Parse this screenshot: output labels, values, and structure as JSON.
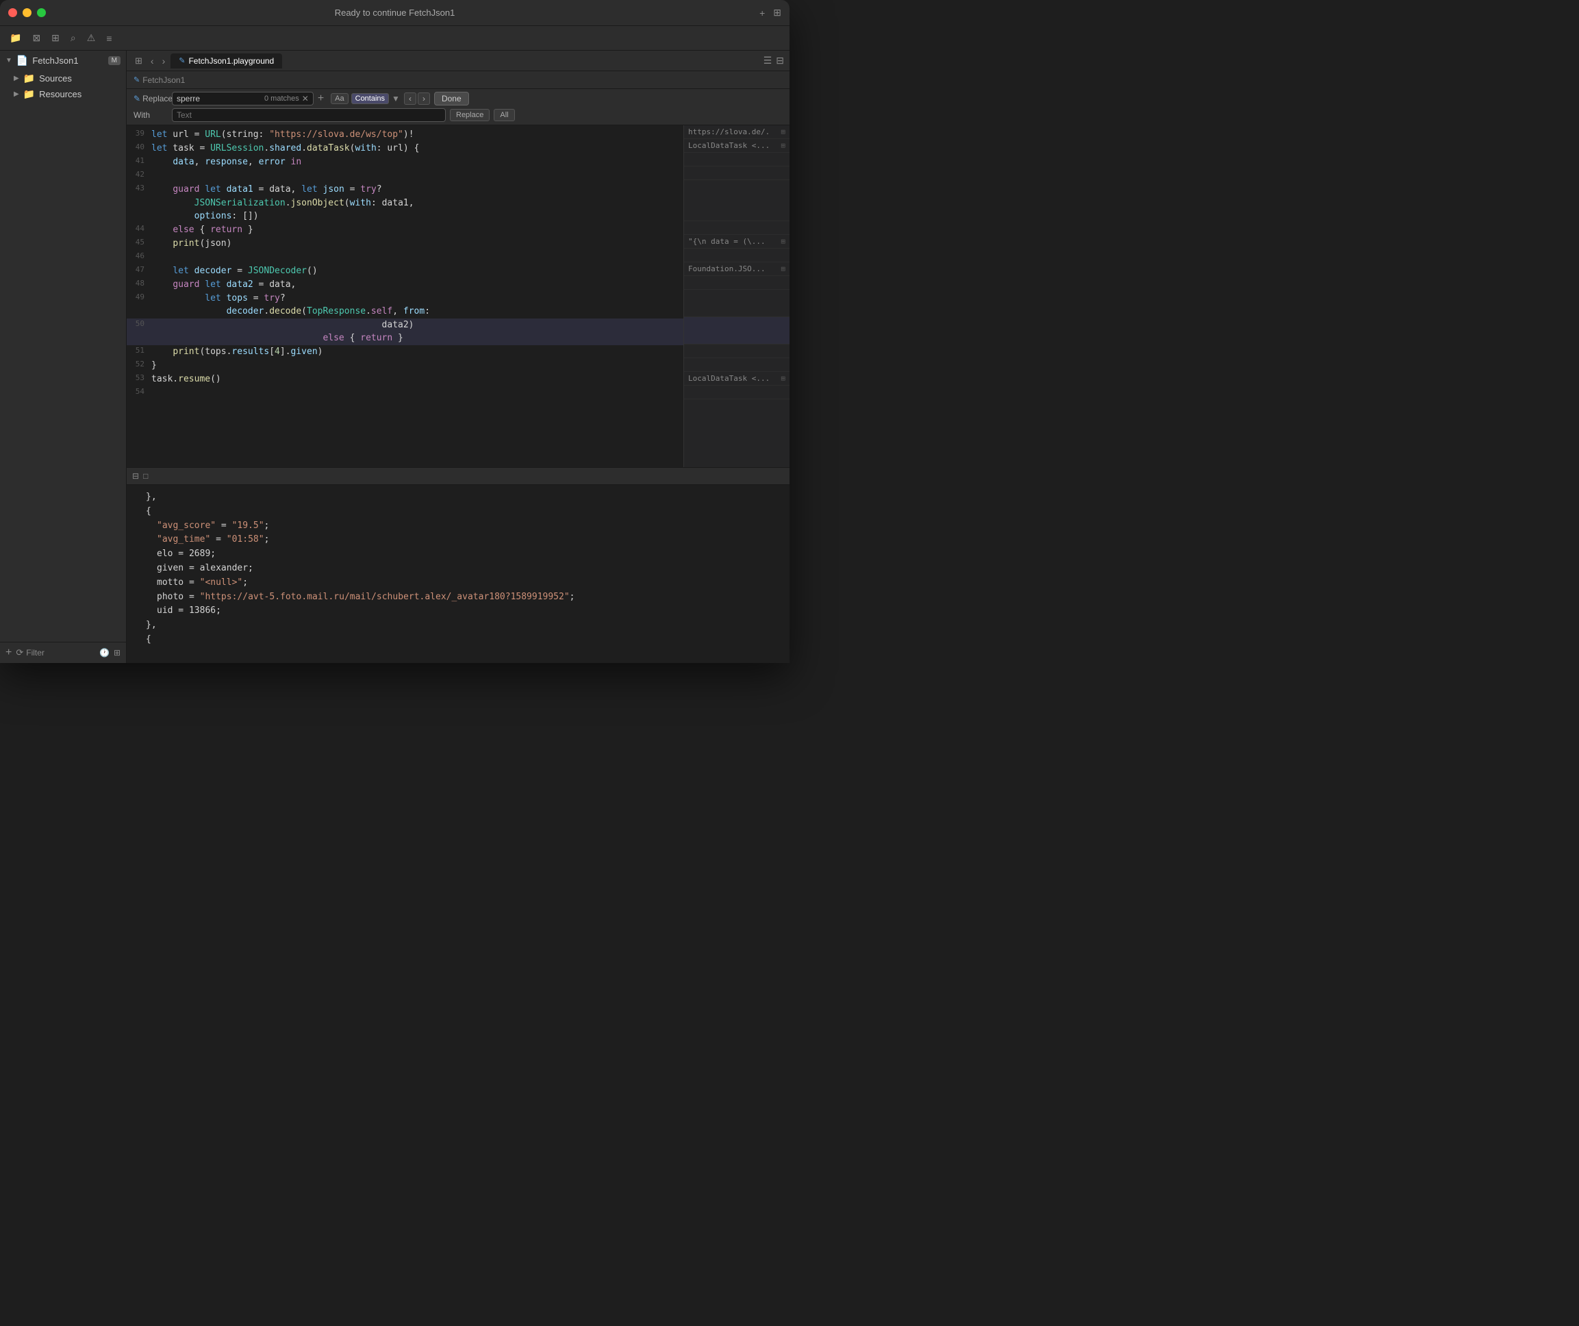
{
  "titlebar": {
    "title": "Ready to continue FetchJson1",
    "traffic_lights": [
      "red",
      "yellow",
      "green"
    ]
  },
  "toolbar": {
    "icons": [
      "folder",
      "x-square",
      "grid",
      "search",
      "warning",
      "list"
    ]
  },
  "sidebar": {
    "project_name": "FetchJson1",
    "badge": "M",
    "items": [
      {
        "label": "Sources",
        "type": "folder",
        "expanded": true
      },
      {
        "label": "Resources",
        "type": "folder",
        "expanded": false
      }
    ],
    "footer": {
      "add_label": "+",
      "filter_label": "Filter"
    }
  },
  "tabs": [
    {
      "label": "FetchJson1.playground",
      "active": true
    }
  ],
  "breadcrumb": "FetchJson1",
  "find_bar": {
    "replace_label": "Replace",
    "find_placeholder": "sperre",
    "find_value": "sperre",
    "matches": "0 matches",
    "option_aa": "Aa",
    "option_contains": "Contains",
    "with_label": "With",
    "with_placeholder": "Text",
    "replace_button": "Replace",
    "all_button": "All",
    "done_button": "Done"
  },
  "code_lines": [
    {
      "num": "39",
      "content": "let url = URL(string: \"https://slova.de/ws/top\")!",
      "highlight": false
    },
    {
      "num": "40",
      "content": "let task = URLSession.shared.dataTask(with: url) {",
      "highlight": false
    },
    {
      "num": "41",
      "content": "    data, response, error in",
      "highlight": false
    },
    {
      "num": "42",
      "content": "",
      "highlight": false
    },
    {
      "num": "43",
      "content": "    guard let data1 = data, let json = try?\n        JSONSerialization.jsonObject(with: data1,\n        options: [])",
      "highlight": false
    },
    {
      "num": "44",
      "content": "    else { return }",
      "highlight": false
    },
    {
      "num": "45",
      "content": "    print(json)",
      "highlight": false
    },
    {
      "num": "46",
      "content": "",
      "highlight": false
    },
    {
      "num": "47",
      "content": "    let decoder = JSONDecoder()",
      "highlight": false
    },
    {
      "num": "48",
      "content": "    guard let data2 = data,",
      "highlight": false
    },
    {
      "num": "49",
      "content": "          let tops = try?\n              decoder.decode(TopResponse.self, from:",
      "highlight": false
    },
    {
      "num": "50",
      "content": "                                           data2)\n                                else { return }",
      "highlight": true
    },
    {
      "num": "51",
      "content": "    print(tops.results[4].given)",
      "highlight": false
    },
    {
      "num": "52",
      "content": "}",
      "highlight": false
    },
    {
      "num": "53",
      "content": "task.resume()",
      "highlight": false
    },
    {
      "num": "54",
      "content": "",
      "highlight": false
    }
  ],
  "gutter_items": [
    {
      "line": 39,
      "text": "https://slova.de/...",
      "show": true
    },
    {
      "line": 40,
      "text": "LocalDataTask <...",
      "show": true
    },
    {
      "line": 41,
      "text": "",
      "show": false
    },
    {
      "line": 42,
      "text": "",
      "show": false
    },
    {
      "line": 43,
      "text": "",
      "show": false
    },
    {
      "line": 44,
      "text": "",
      "show": false
    },
    {
      "line": 45,
      "text": "\"{\\n  data =  (\\...",
      "show": true
    },
    {
      "line": 46,
      "text": "",
      "show": false
    },
    {
      "line": 47,
      "text": "Foundation.JSO...",
      "show": true
    },
    {
      "line": 48,
      "text": "",
      "show": false
    },
    {
      "line": 49,
      "text": "",
      "show": false
    },
    {
      "line": 50,
      "text": "",
      "show": false
    },
    {
      "line": 51,
      "text": "",
      "show": false
    },
    {
      "line": 52,
      "text": "",
      "show": false
    },
    {
      "line": 53,
      "text": "LocalDataTask <...",
      "show": true
    },
    {
      "line": 54,
      "text": "",
      "show": false
    }
  ],
  "output": {
    "lines": [
      "    },",
      "    {",
      "        \"avg_score\" = \"19.5\";",
      "        \"avg_time\" = \"01:58\";",
      "        elo = 2689;",
      "        given = alexander;",
      "        motto = \"<null>\";",
      "        photo = \"https://avt-5.foto.mail.ru/mail/schubert.alex/_avatar180?1589919952\";",
      "        uid = 13866;",
      "    },",
      "    {"
    ]
  }
}
